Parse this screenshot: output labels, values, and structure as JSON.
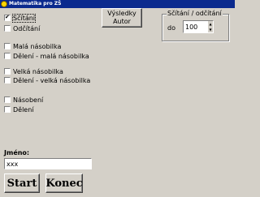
{
  "window": {
    "title": "Matematika pro ZŠ"
  },
  "options": [
    {
      "label": "Sčítání",
      "checked": true
    },
    {
      "label": "Odčítání",
      "checked": false
    },
    {
      "label": "Malá násobilka",
      "checked": false
    },
    {
      "label": "Dělení - malá násobilka",
      "checked": false
    },
    {
      "label": "Velká násobilka",
      "checked": false
    },
    {
      "label": "Dělení - velká násobilka",
      "checked": false
    },
    {
      "label": "Násobení",
      "checked": false
    },
    {
      "label": "Dělení",
      "checked": false
    }
  ],
  "results_button": {
    "line1": "Výsledky",
    "line2": "Autor"
  },
  "range_group": {
    "title": "Sčítání / odčítání",
    "to_label": "do",
    "value": "100"
  },
  "name": {
    "label": "Jméno:",
    "value": "xxx"
  },
  "buttons": {
    "start": "Start",
    "end": "Konec"
  }
}
